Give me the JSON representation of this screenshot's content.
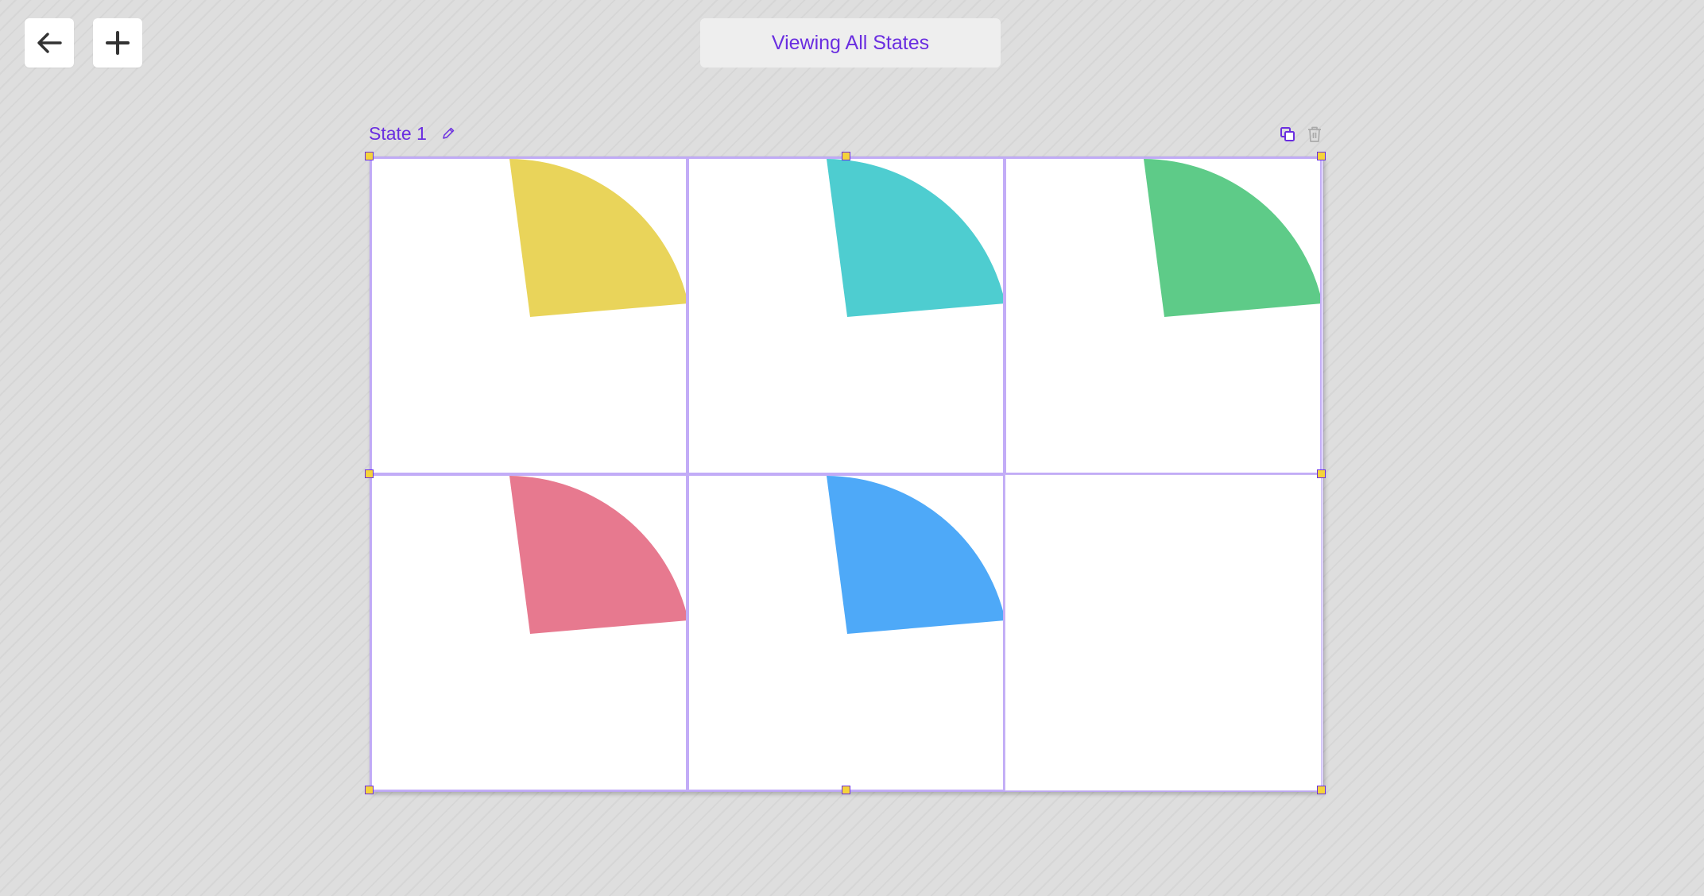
{
  "toolbar": {
    "back_icon": "arrow-left-icon",
    "add_icon": "plus-icon",
    "view_label": "Viewing All States"
  },
  "state": {
    "title": "State 1",
    "edit_icon": "pencil-icon",
    "duplicate_icon": "copy-icon",
    "delete_icon": "trash-icon",
    "frames": [
      {
        "shape": "quarter-circle-wedge",
        "color": "#e9d45a"
      },
      {
        "shape": "quarter-circle-wedge",
        "color": "#4ecdd0"
      },
      {
        "shape": "quarter-circle-wedge",
        "color": "#5ecb88"
      },
      {
        "shape": "quarter-circle-wedge",
        "color": "#e7798f"
      },
      {
        "shape": "quarter-circle-wedge",
        "color": "#4ea9f8"
      },
      {
        "shape": "empty",
        "color": ""
      }
    ]
  },
  "colors": {
    "accent": "#6a2ee0",
    "handle": "#f5d33a",
    "canvas_bg": "#dedede"
  }
}
